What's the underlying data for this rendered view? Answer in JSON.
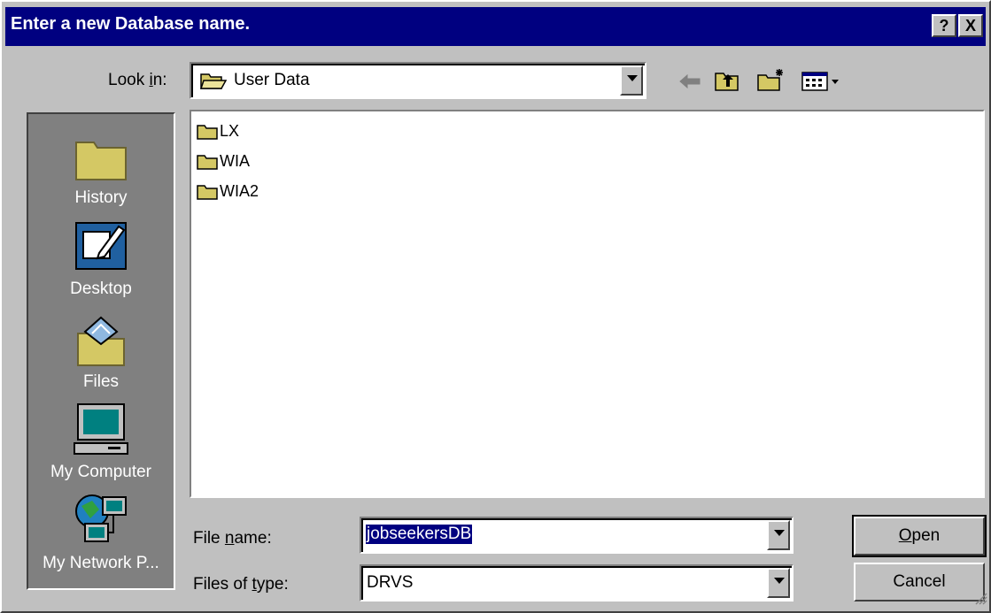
{
  "window": {
    "title": "Enter a new Database name.",
    "help_button": "?",
    "close_button": "X"
  },
  "look_in": {
    "label_pre": "Look ",
    "label_u": "i",
    "label_post": "n:",
    "value": "User Data"
  },
  "toolbar": {
    "icons": [
      "back-icon",
      "up-folder-icon",
      "new-folder-icon",
      "view-menu-icon"
    ]
  },
  "places": [
    {
      "label": "History",
      "icon": "history-folder-icon"
    },
    {
      "label": "Desktop",
      "icon": "desktop-icon"
    },
    {
      "label": "Files",
      "icon": "files-folder-icon"
    },
    {
      "label": "My Computer",
      "icon": "my-computer-icon"
    },
    {
      "label": "My Network P...",
      "icon": "network-places-icon"
    }
  ],
  "files": [
    {
      "name": "LX",
      "icon": "folder-icon"
    },
    {
      "name": "WIA",
      "icon": "folder-icon"
    },
    {
      "name": "WIA2",
      "icon": "folder-icon"
    }
  ],
  "file_name": {
    "label_pre": "File ",
    "label_u": "n",
    "label_post": "ame:",
    "value": "jobseekersDB"
  },
  "file_type": {
    "label_pre": "Files of ",
    "label_u": "t",
    "label_post": "ype:",
    "value": "DRVS"
  },
  "buttons": {
    "open_u": "O",
    "open_rest": "pen",
    "cancel": "Cancel"
  },
  "colors": {
    "titlebar": "#000080",
    "face": "#c0c0c0",
    "selection": "#000080",
    "folder": "#d4c864"
  }
}
